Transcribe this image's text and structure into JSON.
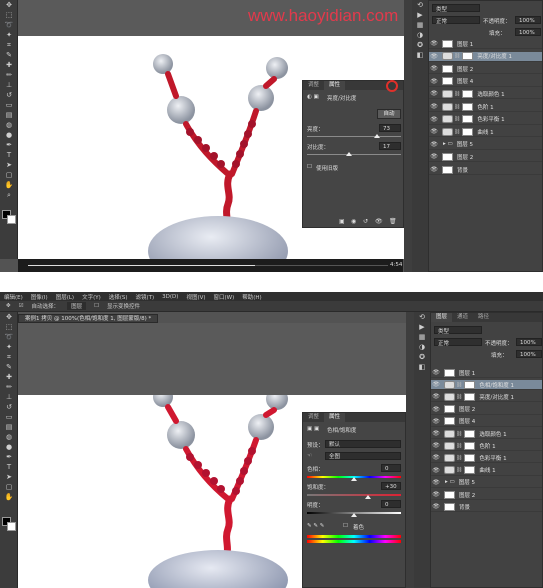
{
  "watermark": "www.haoyidian.com",
  "top": {
    "video": {
      "time": "4:54",
      "progress": 0.63
    },
    "props": {
      "tabs": [
        "调整",
        "属性"
      ],
      "type_label": "亮度/对比度",
      "auto_label": "自动",
      "brightness_label": "亮度：",
      "brightness_value": "73",
      "contrast_label": "对比度：",
      "contrast_value": "17",
      "legacy_label": "使用旧版"
    },
    "layers": {
      "kind": "类型",
      "mode": "正常",
      "opacity_label": "不透明度：",
      "opacity": "100%",
      "fill_label": "填充：",
      "fill": "100%",
      "items": [
        {
          "name": "图层 1",
          "kind": "pixel"
        },
        {
          "name": "亮度/对比度 1",
          "kind": "adj",
          "selected": true
        },
        {
          "name": "图层 2",
          "kind": "pixel"
        },
        {
          "name": "图层 4",
          "kind": "pixel"
        },
        {
          "name": "选取颜色 1",
          "kind": "adj"
        },
        {
          "name": "色阶 1",
          "kind": "adj"
        },
        {
          "name": "色彩平衡 1",
          "kind": "adj"
        },
        {
          "name": "曲线 1",
          "kind": "adj"
        },
        {
          "name": "图层 5",
          "kind": "group"
        },
        {
          "name": "图层 2",
          "kind": "pixel"
        },
        {
          "name": "背景",
          "kind": "pixel"
        }
      ]
    }
  },
  "bottom": {
    "menus": [
      "编辑(E)",
      "图像(I)",
      "图层(L)",
      "文字(Y)",
      "选择(S)",
      "滤镜(T)",
      "3D(D)",
      "视图(V)",
      "窗口(W)",
      "帮助(H)"
    ],
    "options": [
      "自动选择：",
      "图层",
      "显示变换控件"
    ],
    "doc_tab": "案例1 拷贝 @ 100%(色相/饱和度 1, 图层蒙版/8) *",
    "panel_tabs": [
      "图层",
      "通道",
      "路径"
    ],
    "props": {
      "tabs": [
        "调整",
        "属性"
      ],
      "type_label": "色相/饱和度",
      "preset_label": "预设：",
      "preset_value": "默认",
      "channel_value": "全图",
      "hue_label": "色相：",
      "hue_value": "0",
      "sat_label": "饱和度：",
      "sat_value": "+30",
      "light_label": "明度：",
      "light_value": "0",
      "colorize_label": "着色"
    },
    "layers": {
      "kind": "类型",
      "mode": "正常",
      "opacity_label": "不透明度：",
      "opacity": "100%",
      "fill_label": "填充：",
      "fill": "100%",
      "items": [
        {
          "name": "图层 1",
          "kind": "pixel"
        },
        {
          "name": "色相/饱和度 1",
          "kind": "adj",
          "selected": true
        },
        {
          "name": "亮度/对比度 1",
          "kind": "adj"
        },
        {
          "name": "图层 2",
          "kind": "pixel"
        },
        {
          "name": "图层 4",
          "kind": "pixel"
        },
        {
          "name": "选取颜色 1",
          "kind": "adj"
        },
        {
          "name": "色阶 1",
          "kind": "adj"
        },
        {
          "name": "色彩平衡 1",
          "kind": "adj"
        },
        {
          "name": "曲线 1",
          "kind": "adj"
        },
        {
          "name": "图层 5",
          "kind": "group"
        },
        {
          "name": "图层 2",
          "kind": "pixel"
        },
        {
          "name": "背景",
          "kind": "pixel"
        }
      ]
    }
  },
  "icons": [
    "eye-icon",
    "move-tool-icon",
    "chain-icon",
    "trash-icon",
    "folder-icon"
  ]
}
